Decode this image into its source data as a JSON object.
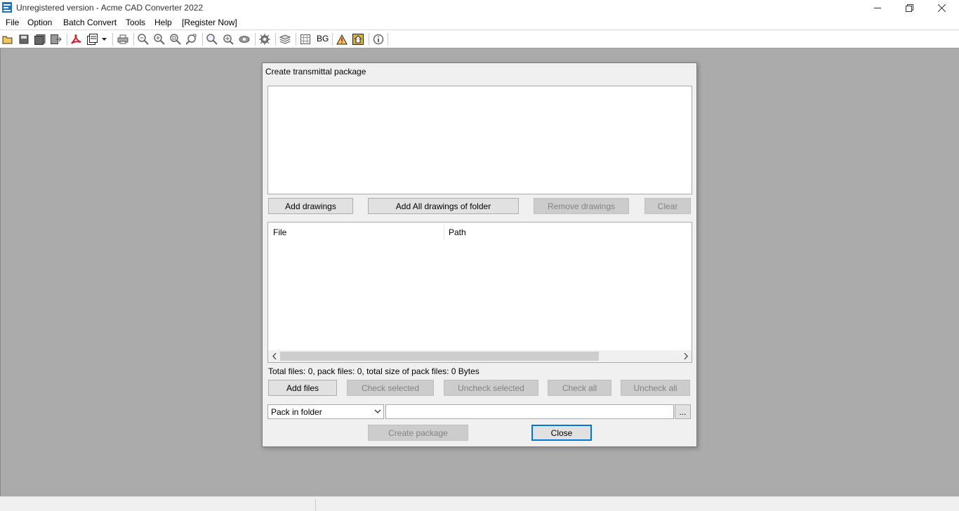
{
  "window": {
    "title": "Unregistered version - Acme CAD Converter 2022"
  },
  "menu": [
    "File",
    "Option",
    "Batch Convert",
    "Tools",
    "Help",
    "[Register Now]"
  ],
  "toolbar": {
    "bg_label": "BG",
    "icons": [
      "open-icon",
      "save-icon",
      "save-all-icon",
      "export-icon",
      "pdf-icon",
      "batch-icon",
      "print-icon",
      "zoom-out-icon",
      "zoom-in-icon",
      "zoom-window-icon",
      "zoom-extents-icon",
      "find-icon",
      "pan-icon",
      "view-icon",
      "settings-icon",
      "layers-icon",
      "grid-icon",
      "warning-icon",
      "home-icon",
      "info-icon"
    ]
  },
  "dialog": {
    "title": "Create transmittal package",
    "buttons": {
      "add_drawings": "Add drawings",
      "add_all": "Add All drawings of folder",
      "remove_drawings": "Remove drawings",
      "clear": "Clear",
      "add_files": "Add files",
      "check_selected": "Check selected",
      "uncheck_selected": "Uncheck selected",
      "check_all": "Check all",
      "uncheck_all": "Uncheck all",
      "browse": "...",
      "create_package": "Create package",
      "close": "Close"
    },
    "columns": [
      "File",
      "Path"
    ],
    "summary": "Total files: 0, pack files: 0, total size of pack files: 0 Bytes",
    "pack_mode": "Pack in folder",
    "output_path": ""
  },
  "colors": {
    "workspace": "#ababab",
    "dialog_bg": "#f0f0f0",
    "accent": "#0078d7"
  }
}
